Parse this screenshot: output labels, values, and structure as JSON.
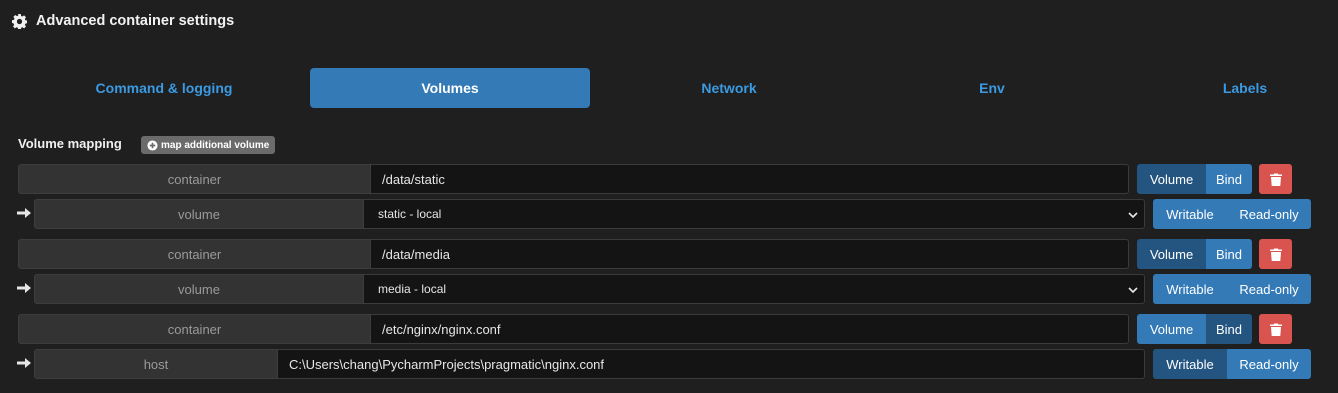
{
  "header": {
    "title": "Advanced container settings",
    "icon": "gear-icon"
  },
  "tabs": [
    {
      "label": "Command & logging",
      "active": false
    },
    {
      "label": "Volumes",
      "active": true
    },
    {
      "label": "Network",
      "active": false
    },
    {
      "label": "Env",
      "active": false
    },
    {
      "label": "Labels",
      "active": false
    }
  ],
  "volumes": {
    "section_label": "Volume mapping",
    "add_button": "map additional volume",
    "mappings": [
      {
        "container_label": "container",
        "container_path": "/data/static",
        "type_buttons": [
          "Volume",
          "Bind"
        ],
        "selected_type": "Volume",
        "source_label": "volume",
        "source_value": "static - local",
        "access_buttons": [
          "Writable",
          "Read-only"
        ]
      },
      {
        "container_label": "container",
        "container_path": "/data/media",
        "type_buttons": [
          "Volume",
          "Bind"
        ],
        "selected_type": "Volume",
        "source_label": "volume",
        "source_value": "media - local",
        "access_buttons": [
          "Writable",
          "Read-only"
        ]
      },
      {
        "container_label": "container",
        "container_path": "/etc/nginx/nginx.conf",
        "type_buttons": [
          "Volume",
          "Bind"
        ],
        "selected_type": "Bind",
        "source_label": "host",
        "source_value": "C:\\Users\\chang\\PycharmProjects\\pragmatic\\nginx.conf",
        "access_buttons": [
          "Writable",
          "Read-only"
        ]
      }
    ]
  },
  "colors": {
    "accent": "#337ab7",
    "accent_dark": "#245580",
    "danger": "#d9534f",
    "link": "#3b9ae1",
    "background": "#1f1f1f"
  }
}
